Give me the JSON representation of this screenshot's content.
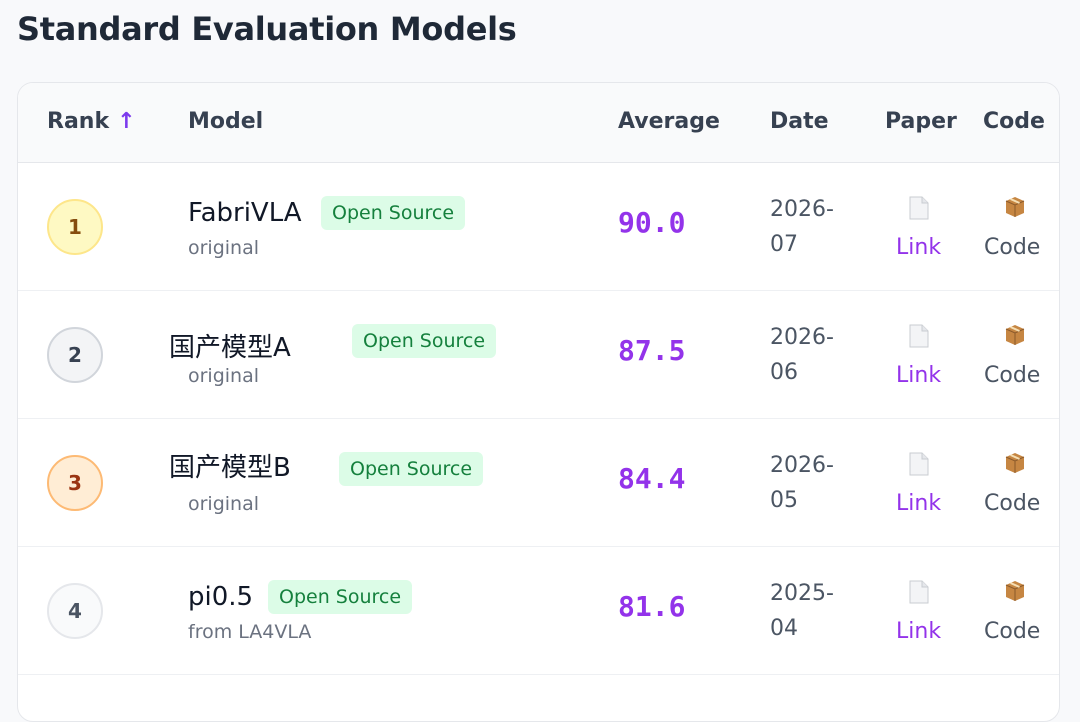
{
  "page": {
    "title": "Standard Evaluation Models"
  },
  "table": {
    "headers": {
      "rank": "Rank",
      "sort_indicator": "↑",
      "model": "Model",
      "average": "Average",
      "date": "Date",
      "paper": "Paper",
      "code": "Code"
    },
    "rows": [
      {
        "rank": "1",
        "model": "FabriVLA",
        "tag": "Open Source",
        "sub": "original",
        "average": "90.0",
        "date": "2026-07",
        "paper_link": "Link",
        "code_link": "Code"
      },
      {
        "rank": "2",
        "model": "国产模型A",
        "tag": "Open Source",
        "sub": "original",
        "average": "87.5",
        "date": "2026-06",
        "paper_link": "Link",
        "code_link": "Code"
      },
      {
        "rank": "3",
        "model": "国产模型B",
        "tag": "Open Source",
        "sub": "original",
        "average": "84.4",
        "date": "2026-05",
        "paper_link": "Link",
        "code_link": "Code"
      },
      {
        "rank": "4",
        "model": "pi0.5",
        "tag": "Open Source",
        "sub": "from LA4VLA",
        "average": "81.6",
        "date": "2025-04",
        "paper_link": "Link",
        "code_link": "Code"
      }
    ]
  },
  "icons": {
    "paper": "document-icon",
    "code": "package-icon"
  },
  "colors": {
    "accent": "#9333ea",
    "tag_bg": "#dcfce7",
    "tag_text": "#15803d"
  }
}
